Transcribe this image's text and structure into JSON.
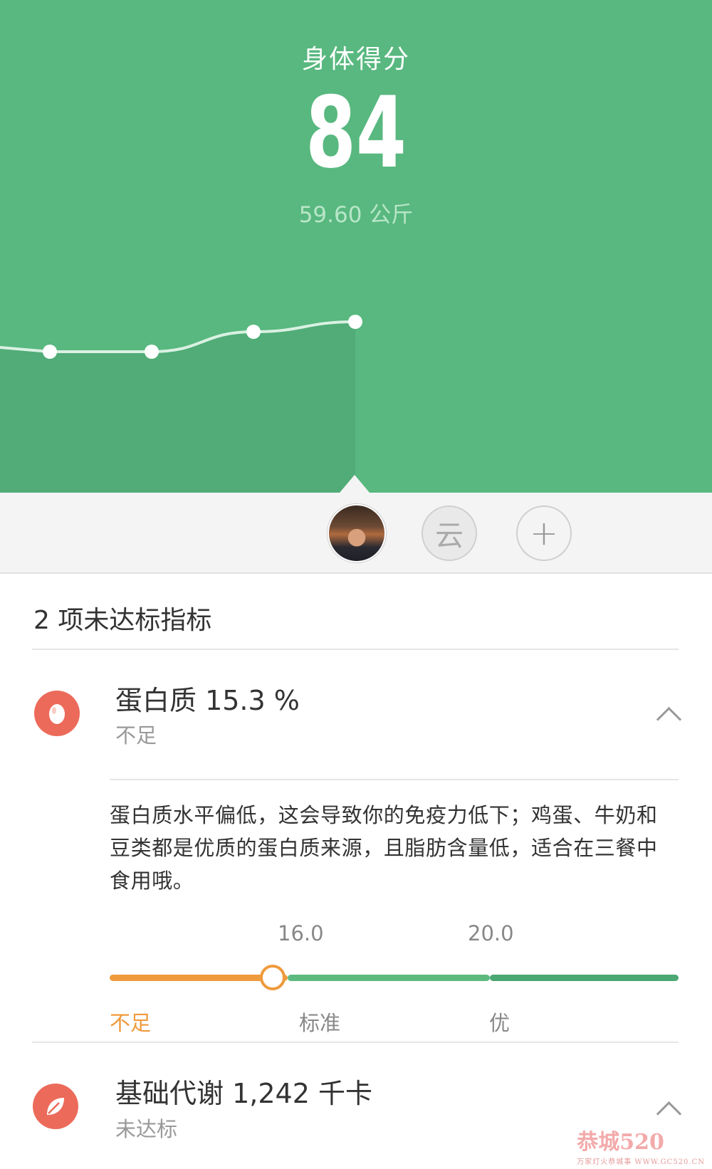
{
  "header": {
    "title": "身体得分",
    "score": "84",
    "weight": "59.60 公斤"
  },
  "trend": {
    "points": [
      59.3,
      59.3,
      59.5,
      59.6
    ],
    "selected_index": 3
  },
  "users": {
    "cloud_label": "云",
    "add_label": "+"
  },
  "section": {
    "title": "2 项未达标指标"
  },
  "metrics": [
    {
      "name": "蛋白质 15.3 %",
      "status": "不足",
      "icon": "egg-icon",
      "advice": "蛋白质水平偏低，这会导致你的免疫力低下；鸡蛋、牛奶和豆类都是优质的蛋白质来源，且脂肪含量低，适合在三餐中食用哦。",
      "scale": {
        "ticks": [
          "16.0",
          "20.0"
        ],
        "labels": [
          "不足",
          "标准",
          "优"
        ],
        "value": 15.3,
        "min": 11.0,
        "max": 26.0
      }
    },
    {
      "name": "基础代谢 1,242 千卡",
      "status": "未达标",
      "icon": "leaf-icon"
    }
  ],
  "colors": {
    "brand_green": "#58b87f",
    "warning_orange": "#ef9a3c",
    "alert_red": "#ec6a5a"
  },
  "watermark": {
    "text": "恭城520",
    "sub": "万家灯火恭城事 WWW.GC520.CN"
  }
}
